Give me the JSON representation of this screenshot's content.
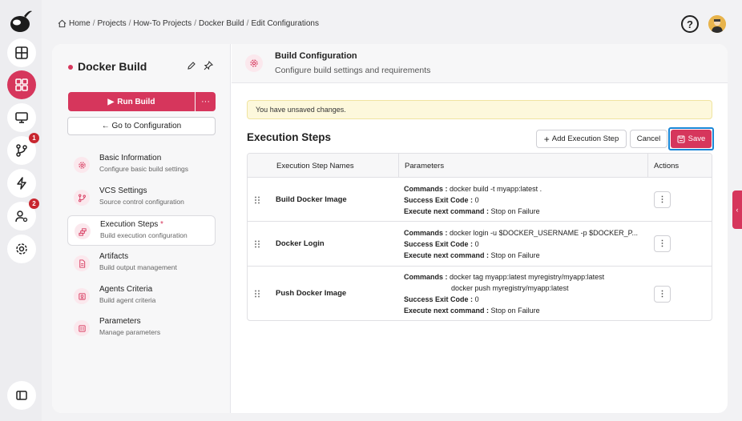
{
  "breadcrumb": {
    "items": [
      "Home",
      "Projects",
      "How-To Projects",
      "Docker Build",
      "Edit Configurations"
    ]
  },
  "rail": {
    "badges": {
      "vcs": "1",
      "users": "2"
    }
  },
  "project": {
    "title": "Docker Build",
    "run_label": "Run Build",
    "more_label": "···",
    "goto_label": "← Go to Configuration"
  },
  "nav": [
    {
      "title": "Basic Information",
      "sub": "Configure basic build settings",
      "icon": "gear-icon"
    },
    {
      "title": "VCS Settings",
      "sub": "Source control configuration",
      "icon": "branch-icon"
    },
    {
      "title": "Execution Steps",
      "req": "*",
      "sub": "Build execution configuration",
      "icon": "steps-icon"
    },
    {
      "title": "Artifacts",
      "sub": "Build output management",
      "icon": "file-icon"
    },
    {
      "title": "Agents Criteria",
      "sub": "Build agent criteria",
      "icon": "agent-icon"
    },
    {
      "title": "Parameters",
      "sub": "Manage parameters",
      "icon": "sliders-icon"
    }
  ],
  "header": {
    "title": "Build Configuration",
    "subtitle": "Configure build settings and requirements"
  },
  "warning": "You have unsaved changes.",
  "section": {
    "title": "Execution Steps",
    "add_label": "Add Execution Step",
    "cancel_label": "Cancel",
    "save_label": "Save"
  },
  "table": {
    "headers": [
      "Execution Step Names",
      "Parameters",
      "Actions"
    ],
    "labels": {
      "commands": "Commands :",
      "exit_code": "Success Exit Code :",
      "next": "Execute next command :"
    },
    "rows": [
      {
        "name": "Build Docker Image",
        "commands": [
          "docker build -t myapp:latest ."
        ],
        "exit_code": "0",
        "next": "Stop on Failure"
      },
      {
        "name": "Docker Login",
        "commands": [
          "docker login -u $DOCKER_USERNAME -p $DOCKER_P..."
        ],
        "exit_code": "0",
        "next": "Stop on Failure"
      },
      {
        "name": "Push Docker Image",
        "commands": [
          "docker tag myapp:latest myregistry/myapp:latest",
          "docker push myregistry/myapp:latest"
        ],
        "exit_code": "0",
        "next": "Stop on Failure"
      }
    ]
  },
  "colors": {
    "accent": "#d6365c",
    "focus": "#1a86d6",
    "warning_bg": "#fdf8dc"
  }
}
